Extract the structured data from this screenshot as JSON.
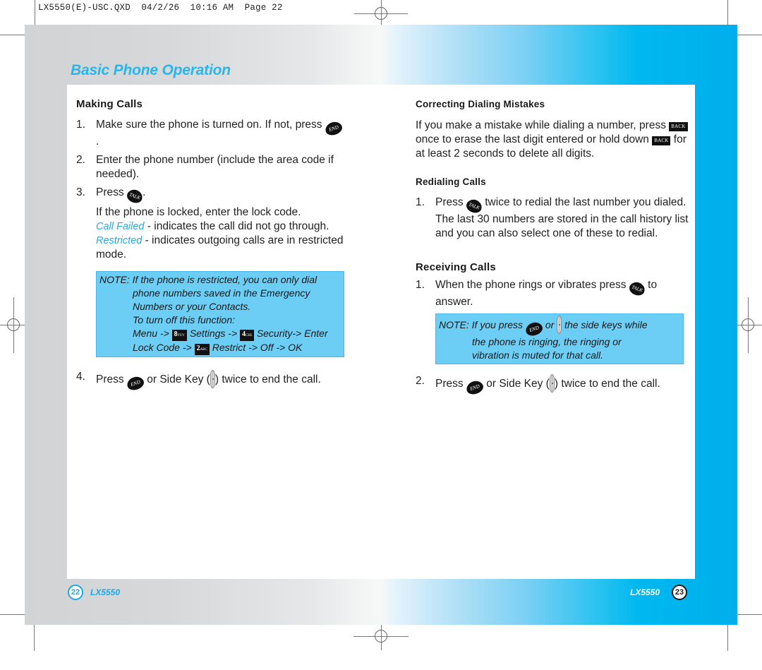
{
  "slug": "LX5550(E)-USC.QXD  04/2/26  10:16 AM  Page 22",
  "title": "Basic Phone Operation",
  "colors": {
    "accent": "#27b6ee",
    "note_bg": "#6dcef5",
    "band_blue": "#00aeeb",
    "band_gray": "#d1d3d5"
  },
  "icons": {
    "end": "END",
    "talk": "TALK",
    "back": "BACK",
    "key8": "8",
    "key8_sub": "TUV",
    "key4": "4",
    "key4_sub": "GHI",
    "key2": "2",
    "key2_sub": "ABC"
  },
  "left": {
    "heading": "Making Calls",
    "steps": [
      {
        "num": "1.",
        "text_a": "Make sure the phone is turned on. If not, press",
        "text_b": "."
      },
      {
        "num": "2.",
        "text": "Enter the phone number (include the area code if needed)."
      },
      {
        "num": "3.",
        "text_a": "Press",
        "text_b": "."
      }
    ],
    "locked_text": "If the phone is locked, enter the lock code.",
    "call_failed_term": "Call Failed",
    "call_failed_desc": " - indicates the call did not go through.",
    "restricted_term": "Restricted",
    "restricted_desc": " - indicates outgoing calls are in restricted mode.",
    "note": {
      "prefix": "NOTE:",
      "line1": "If the phone is restricted, you can only dial",
      "line2": "phone numbers saved in the Emergency",
      "line3": "Numbers or your Contacts.",
      "line4": "To turn off this function:",
      "menu": "Menu ->",
      "settings": "Settings ->",
      "security": "Security-> Enter",
      "lock_code": "Lock Code ->",
      "restrict": "Restrict -> Off -> OK"
    },
    "step4": {
      "num": "4.",
      "text_a": "Press",
      "text_b": "or Side Key (",
      "text_c": ") twice to end the call."
    }
  },
  "right": {
    "correcting_heading": "Correcting Dialing Mistakes",
    "correcting_a": "If you make a mistake while dialing a number, press",
    "correcting_b": "once to erase the last digit entered or hold down",
    "correcting_c": "for at least 2 seconds to delete all digits.",
    "redialing_heading": "Redialing Calls",
    "redial_step": {
      "num": "1.",
      "text_a": "Press",
      "text_b": "twice to redial the last number you dialed. The last 30 numbers are stored in the call history list and you can also select one of these to redial."
    },
    "receiving_heading": "Receiving Calls",
    "receive_step1": {
      "num": "1.",
      "text_a": "When the phone rings or vibrates press",
      "text_b": "to answer."
    },
    "note": {
      "prefix": "NOTE:",
      "line1_a": "If you press",
      "line1_b": "or",
      "line1_c": "the side keys while",
      "line2": "the phone is ringing, the ringing or",
      "line3": "vibration is muted for that call."
    },
    "receive_step2": {
      "num": "2.",
      "text_a": "Press",
      "text_b": "or Side Key (",
      "text_c": ") twice to end the call."
    }
  },
  "footer": {
    "left_page": "22",
    "left_model": "LX5550",
    "right_model": "LX5550",
    "right_page": "23"
  }
}
